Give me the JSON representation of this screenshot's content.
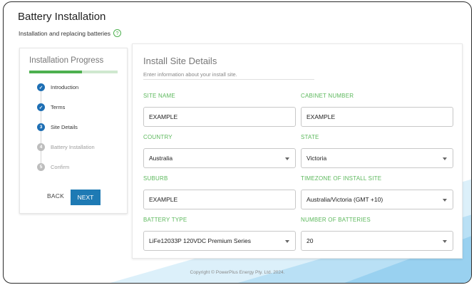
{
  "page": {
    "title": "Battery Installation",
    "subtitle": "Installation and replacing batteries",
    "help_icon": "?"
  },
  "progress": {
    "title": "Installation Progress",
    "fraction_complete": 0.6,
    "steps": [
      {
        "label": "Introduction",
        "state": "done",
        "marker": "✓"
      },
      {
        "label": "Terms",
        "state": "done",
        "marker": "✓"
      },
      {
        "label": "Site Details",
        "state": "active",
        "marker": "3"
      },
      {
        "label": "Battery Installation",
        "state": "todo",
        "marker": "4"
      },
      {
        "label": "Confirm",
        "state": "todo",
        "marker": "5"
      }
    ],
    "back_label": "BACK",
    "next_label": "NEXT"
  },
  "details": {
    "title": "Install Site Details",
    "subtitle": "Enter information about your install site.",
    "fields": {
      "site_name": {
        "label": "SITE NAME",
        "value": "EXAMPLE"
      },
      "cabinet_number": {
        "label": "CABINET NUMBER",
        "value": "EXAMPLE"
      },
      "country": {
        "label": "COUNTRY",
        "value": "Australia"
      },
      "state": {
        "label": "STATE",
        "value": "Victoria"
      },
      "suburb": {
        "label": "SUBURB",
        "value": "EXAMPLE"
      },
      "timezone": {
        "label": "TIMEZONE OF INSTALL SITE",
        "value": "Australia/Victoria (GMT +10)"
      },
      "battery_type": {
        "label": "BATTERY TYPE",
        "value": "LiFe12033P 120VDC Premium Series"
      },
      "number_of_batteries": {
        "label": "NUMBER OF BATTERIES",
        "value": "20"
      }
    }
  },
  "footer": {
    "copyright": "Copyright © PowerPlus Energy Pty. Ltd. 2024."
  },
  "colors": {
    "accent_green": "#4db04f",
    "button_blue": "#1e7ab4",
    "step_blue": "#1e6fb4"
  }
}
